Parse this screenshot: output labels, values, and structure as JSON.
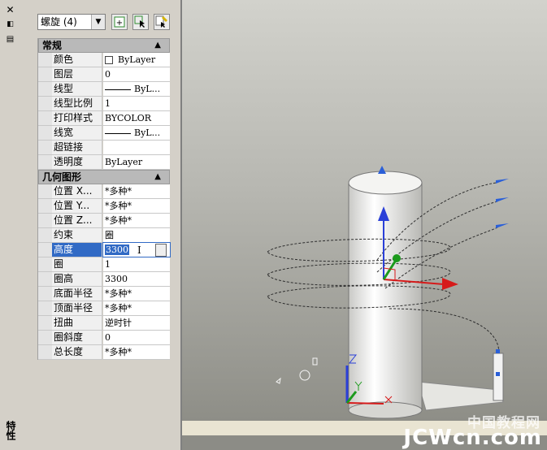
{
  "palette": {
    "title": "特性",
    "object_select": {
      "value": "螺旋 (4)"
    },
    "sections": [
      {
        "name": "常规",
        "rows": [
          {
            "label": "颜色",
            "value": "ByLayer",
            "icon": "swatch"
          },
          {
            "label": "图层",
            "value": "0"
          },
          {
            "label": "线型",
            "value": "ByL...",
            "icon": "line"
          },
          {
            "label": "线型比例",
            "value": "1"
          },
          {
            "label": "打印样式",
            "value": "BYCOLOR"
          },
          {
            "label": "线宽",
            "value": "ByL...",
            "icon": "line"
          },
          {
            "label": "超链接",
            "value": ""
          },
          {
            "label": "透明度",
            "value": "ByLayer"
          }
        ]
      },
      {
        "name": "几何图形",
        "rows": [
          {
            "label": "位置 X...",
            "value": "*多种*"
          },
          {
            "label": "位置 Y...",
            "value": "*多种*"
          },
          {
            "label": "位置 Z...",
            "value": "*多种*"
          },
          {
            "label": "约束",
            "value": "圈"
          },
          {
            "label": "高度",
            "value": "3300",
            "active": true
          },
          {
            "label": "圈",
            "value": "1"
          },
          {
            "label": "圈高",
            "value": "3300"
          },
          {
            "label": "底面半径",
            "value": "*多种*"
          },
          {
            "label": "顶面半径",
            "value": "*多种*"
          },
          {
            "label": "扭曲",
            "value": "逆时针"
          },
          {
            "label": "圈斜度",
            "value": "0"
          },
          {
            "label": "总长度",
            "value": "*多种*"
          }
        ]
      }
    ]
  },
  "watermark": {
    "cn": "中国教程网",
    "en": "JCWcn.com"
  },
  "colors": {
    "selection": "#316ac5",
    "axis_x": "#d61a1a",
    "axis_y": "#1c9a1c",
    "axis_z": "#2a3fd8",
    "grip": "#2a5fd8"
  }
}
